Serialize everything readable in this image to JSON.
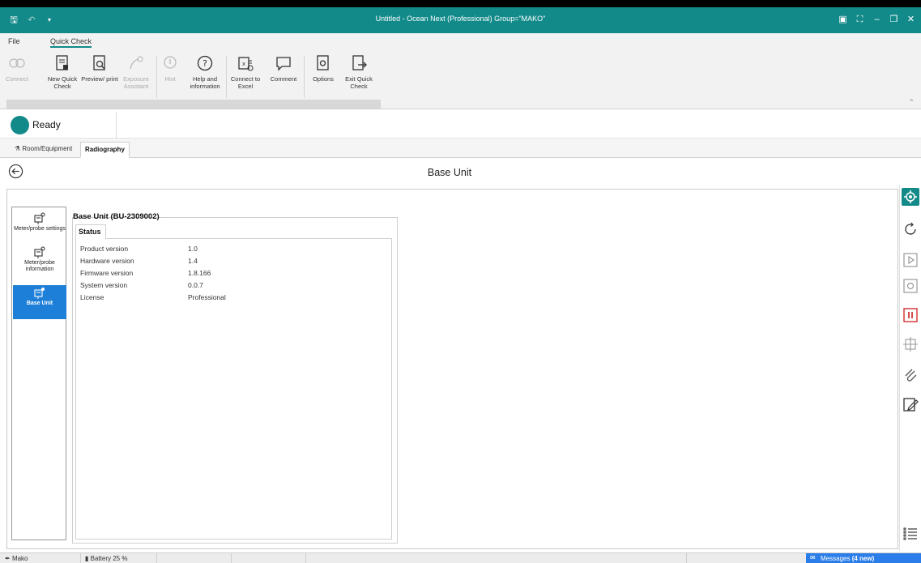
{
  "window": {
    "title": "Untitled - Ocean Next (Professional)   Group=\"MAKO\"",
    "accent": "#138a8a"
  },
  "menu": {
    "file": "File",
    "quick_check": "Quick Check"
  },
  "ribbon": {
    "connect": "Connect",
    "new_quick_check": "New Quick Check",
    "preview_print": "Preview/ print",
    "exposure_assistant": "Exposure Assistant",
    "hint": "Hint",
    "help_information": "Help and information",
    "connect_excel": "Connect to Excel",
    "comment": "Comment",
    "options": "Options",
    "exit_quick_check": "Exit Quick Check"
  },
  "status": {
    "label": "Ready"
  },
  "tabs": [
    {
      "label": "Room/Equipment"
    },
    {
      "label": "Radiography"
    }
  ],
  "header": {
    "title": "Base Unit"
  },
  "leftnav": [
    {
      "label": "Meter/probe settings"
    },
    {
      "label": "Meter/probe information"
    },
    {
      "label": "Base Unit"
    }
  ],
  "base_unit": {
    "group_title": "Base Unit (BU-2309002)",
    "tab_label": "Status",
    "rows": [
      {
        "key": "Product version",
        "value": "1.0"
      },
      {
        "key": "Hardware version",
        "value": "1.4"
      },
      {
        "key": "Firmware version",
        "value": "1.8.166"
      },
      {
        "key": "System version",
        "value": "0.0.7"
      },
      {
        "key": "License",
        "value": "Professional"
      }
    ]
  },
  "statusbar": {
    "user": "Mako",
    "battery": "Battery 25 %",
    "messages": "Messages",
    "messages_new": "(4 new)"
  }
}
